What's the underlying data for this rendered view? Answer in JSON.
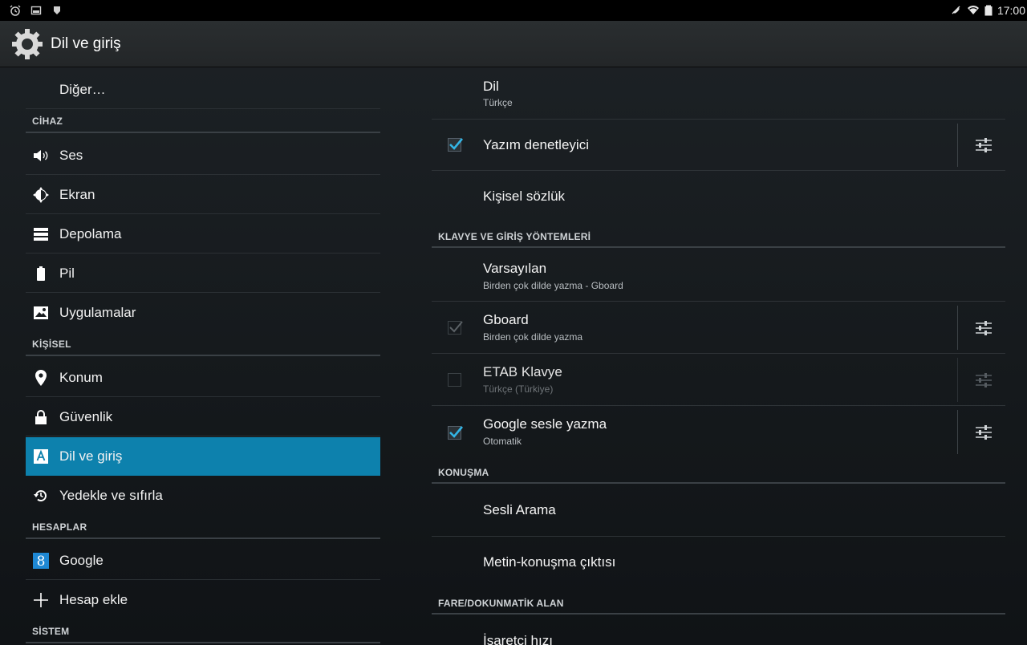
{
  "status_bar": {
    "time": "17:00",
    "left_icons": [
      "alarm-icon",
      "screenshot-icon",
      "shield-icon"
    ],
    "right_icons": [
      "mute-icon",
      "wifi-icon",
      "battery-icon"
    ]
  },
  "action_bar": {
    "title": "Dil ve giriş",
    "icon": "settings-gear-icon"
  },
  "left_pane": {
    "top_item": "Diğer…",
    "sections": [
      {
        "header": "CİHAZ",
        "items": [
          {
            "label": "Ses",
            "icon": "volume-icon"
          },
          {
            "label": "Ekran",
            "icon": "brightness-icon"
          },
          {
            "label": "Depolama",
            "icon": "storage-icon"
          },
          {
            "label": "Pil",
            "icon": "battery-icon"
          },
          {
            "label": "Uygulamalar",
            "icon": "apps-icon"
          }
        ]
      },
      {
        "header": "KİŞİSEL",
        "items": [
          {
            "label": "Konum",
            "icon": "location-icon"
          },
          {
            "label": "Güvenlik",
            "icon": "lock-icon"
          },
          {
            "label": "Dil ve giriş",
            "icon": "language-icon",
            "selected": true
          },
          {
            "label": "Yedekle ve sıfırla",
            "icon": "restore-icon"
          }
        ]
      },
      {
        "header": "HESAPLAR",
        "items": [
          {
            "label": "Google",
            "icon": "google-icon"
          },
          {
            "label": "Hesap ekle",
            "icon": "plus-icon"
          }
        ]
      },
      {
        "header": "SİSTEM",
        "items": []
      }
    ]
  },
  "right_pane": {
    "language": {
      "title": "Dil",
      "value": "Türkçe"
    },
    "spell_checker": {
      "title": "Yazım denetleyici",
      "checked": true
    },
    "personal_dictionary": {
      "title": "Kişisel sözlük"
    },
    "keyboard_header": "KLAVYE VE GİRİŞ YÖNTEMLERİ",
    "default_keyboard": {
      "title": "Varsayılan",
      "value": "Birden çok dilde yazma - Gboard"
    },
    "gboard": {
      "title": "Gboard",
      "sub": "Birden çok dilde yazma",
      "checked": true,
      "disabled_check": true
    },
    "etab": {
      "title": "ETAB Klavye",
      "sub": "Türkçe (Türkiye)",
      "checked": false,
      "disabled": true
    },
    "google_voice": {
      "title": "Google sesle yazma",
      "sub": "Otomatik",
      "checked": true
    },
    "speech_header": "KONUŞMA",
    "voice_search": {
      "title": "Sesli Arama"
    },
    "tts": {
      "title": "Metin-konuşma çıktısı"
    },
    "mouse_header": "FARE/DOKUNMATİK ALAN",
    "pointer_speed": {
      "title": "İşaretçi hızı"
    }
  },
  "colors": {
    "selected_bg": "#0d81ad",
    "checkbox_accent": "#33b5e5"
  }
}
